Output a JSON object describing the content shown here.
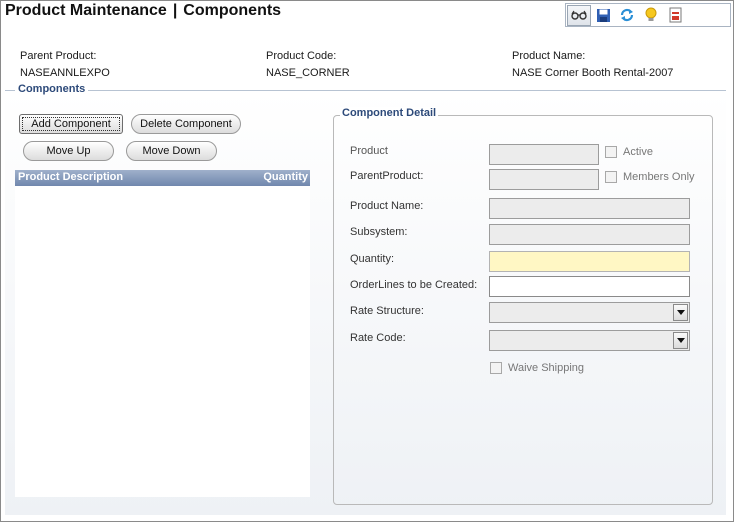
{
  "page": {
    "title_left": "Product Maintenance",
    "title_sep": "|",
    "title_right": "Components"
  },
  "toolbar": {
    "buttons": [
      {
        "icon": "glasses-icon",
        "pressed": true
      },
      {
        "icon": "save-icon"
      },
      {
        "icon": "refresh-icon"
      },
      {
        "icon": "lightbulb-icon"
      },
      {
        "icon": "report-icon"
      }
    ]
  },
  "header": {
    "parent_product_label": "Parent Product:",
    "parent_product_value": "NASEANNLEXPO",
    "product_code_label": "Product Code:",
    "product_code_value": "NASE_CORNER",
    "product_name_label": "Product Name:",
    "product_name_value": "NASE Corner Booth Rental-2007"
  },
  "components": {
    "legend": "Components",
    "add_label": "Add Component",
    "delete_label": "Delete Component",
    "move_up_label": "Move Up",
    "move_down_label": "Move Down",
    "columns": [
      "Product Description",
      "Quantity"
    ],
    "rows": []
  },
  "detail": {
    "legend": "Component Detail",
    "product_label": "Product",
    "parent_product_label": "ParentProduct:",
    "product_name_label": "Product Name:",
    "subsystem_label": "Subsystem:",
    "quantity_label": "Quantity:",
    "orderlines_label": "OrderLines to be Created:",
    "rate_structure_label": "Rate Structure:",
    "rate_code_label": "Rate Code:",
    "active_label": "Active",
    "members_only_label": "Members Only",
    "waive_shipping_label": "Waive Shipping",
    "product_value": "",
    "parent_product_value": "",
    "product_name_value": "",
    "subsystem_value": "",
    "quantity_value": "",
    "orderlines_value": "",
    "rate_structure_value": "",
    "rate_code_value": ""
  },
  "colors": {
    "legend": "#2d4a7a",
    "list_header": "#7087ad",
    "quantity_field": "#fff7c4"
  }
}
